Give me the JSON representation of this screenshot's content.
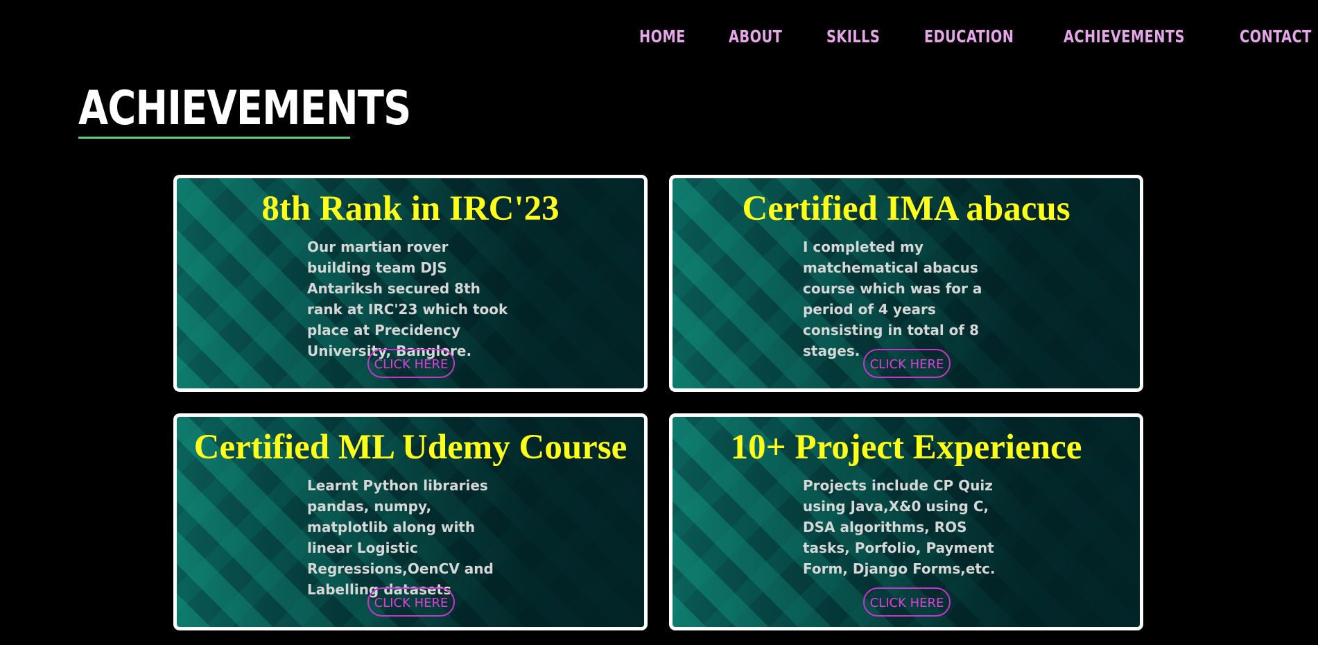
{
  "nav": {
    "items": [
      "HOME",
      "ABOUT",
      "SKILLS",
      "EDUCATION",
      "ACHIEVEMENTS",
      "CONTACT"
    ]
  },
  "section": {
    "title": "ACHIEVEMENTS"
  },
  "cards": [
    {
      "title": "8th Rank in IRC'23",
      "text": "Our martian rover building team DJS Antariksh secured 8th rank at IRC'23 which took place at Precidency University, Banglore.",
      "button": "CLICK HERE"
    },
    {
      "title": "Certified IMA abacus",
      "text": "I completed my matchematical abacus course which was for a period of 4 years consisting in total of 8 stages.",
      "button": "CLICK HERE"
    },
    {
      "title": "Certified ML Udemy Course",
      "text": "Learnt Python libraries pandas, numpy, matplotlib along with linear Logistic Regressions,OenCV and Labelling datasets",
      "button": "CLICK HERE"
    },
    {
      "title": "10+ Project Experience",
      "text": "Projects include CP Quiz using Java,X&0 using C, DSA algorithms, ROS tasks, Porfolio, Payment Form, Django Forms,etc.",
      "button": "CLICK HERE"
    }
  ],
  "colors": {
    "background": "#000000",
    "nav_text": "#e7a6ea",
    "title_underline": "#5fd17a",
    "card_title": "#ffff1a",
    "card_text": "#d7d7d7",
    "button_border": "#cc33cc",
    "button_text": "#e040d8",
    "card_border": "#ffffff"
  }
}
